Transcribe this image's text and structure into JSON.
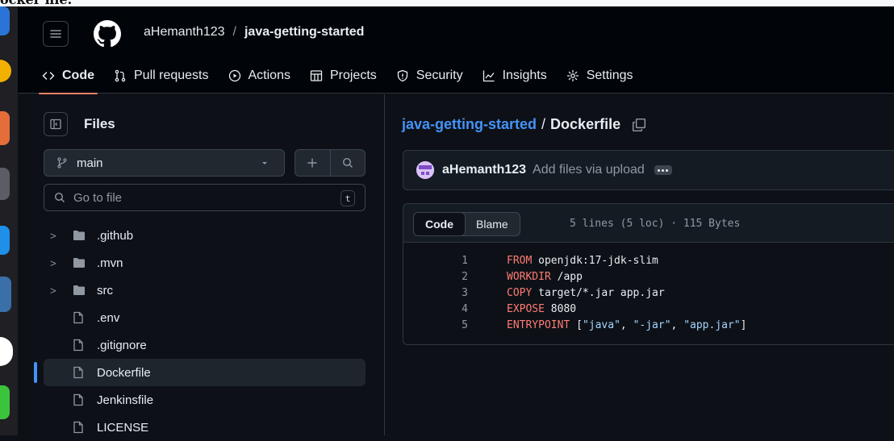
{
  "top_strip_text": "ocker file.",
  "header": {
    "owner": "aHemanth123",
    "separator": "/",
    "repo": "java-getting-started"
  },
  "nav_tabs": [
    {
      "label": "Code",
      "icon": "code-icon"
    },
    {
      "label": "Pull requests",
      "icon": "pull-request-icon"
    },
    {
      "label": "Actions",
      "icon": "play-icon"
    },
    {
      "label": "Projects",
      "icon": "table-icon"
    },
    {
      "label": "Security",
      "icon": "shield-icon"
    },
    {
      "label": "Insights",
      "icon": "graph-icon"
    },
    {
      "label": "Settings",
      "icon": "gear-icon"
    }
  ],
  "sidebar": {
    "title": "Files",
    "branch": "main",
    "search_placeholder": "Go to file",
    "search_shortcut": "t",
    "tree": [
      {
        "name": ".github",
        "type": "folder"
      },
      {
        "name": ".mvn",
        "type": "folder"
      },
      {
        "name": "src",
        "type": "folder"
      },
      {
        "name": ".env",
        "type": "file"
      },
      {
        "name": ".gitignore",
        "type": "file"
      },
      {
        "name": "Dockerfile",
        "type": "file",
        "selected": true
      },
      {
        "name": "Jenkinsfile",
        "type": "file"
      },
      {
        "name": "LICENSE",
        "type": "file"
      }
    ]
  },
  "main": {
    "breadcrumb_repo": "java-getting-started",
    "breadcrumb_sep": "/",
    "file_name": "Dockerfile",
    "commit": {
      "author": "aHemanth123",
      "message": "Add files via upload"
    },
    "code_view": {
      "tab_code": "Code",
      "tab_blame": "Blame",
      "meta": "5 lines (5 loc) · 115 Bytes",
      "lines": [
        {
          "num": "1",
          "keyword": "FROM",
          "rest": " openjdk:17-jdk-slim"
        },
        {
          "num": "2",
          "keyword": "WORKDIR",
          "rest": " /app"
        },
        {
          "num": "3",
          "keyword": "COPY",
          "rest": " target/*.jar app.jar"
        },
        {
          "num": "4",
          "keyword": "EXPOSE",
          "rest": " 8080"
        },
        {
          "num": "5",
          "keyword": "ENTRYPOINT",
          "rest": " [",
          "args": [
            "\"java\"",
            ", ",
            "\"-jar\"",
            ", ",
            "\"app.jar\""
          ],
          "end": "]"
        }
      ]
    }
  },
  "colors": {
    "background": "#0d1117",
    "link": "#4493f8",
    "keyword": "#ff7b72",
    "string": "#a5d6ff",
    "active_tab_underline": "#f78166"
  }
}
